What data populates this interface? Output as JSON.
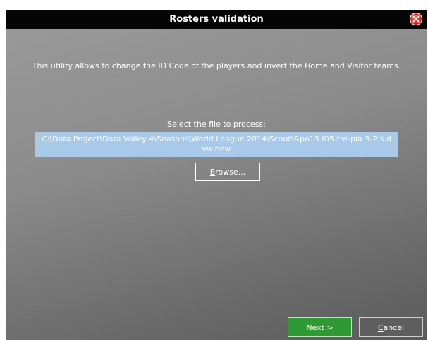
{
  "window": {
    "title": "Rosters validation",
    "close_icon": "close-icon"
  },
  "content": {
    "description": "This utility allows to change the ID Code of the players and invert the Home and Visitor teams.",
    "select_label": "Select the file to process:",
    "file_path": "C:\\Data Project\\Data Volley 4\\Seasons\\World League 2014\\Scout\\&po13 f05 tre-pia 3-2 s.dvw.new",
    "browse": {
      "mnemonic": "B",
      "rest": "rowse..."
    }
  },
  "footer": {
    "next_label": "Next >",
    "cancel": {
      "mnemonic": "C",
      "rest": "ancel"
    }
  },
  "colors": {
    "titlebar": "#050505",
    "background": "#8c8c8c",
    "file_path_bg": "#a9c9e9",
    "next_button": "#2f9a34",
    "cancel_button": "#5e5e5e",
    "close_button": "#e0281a"
  }
}
